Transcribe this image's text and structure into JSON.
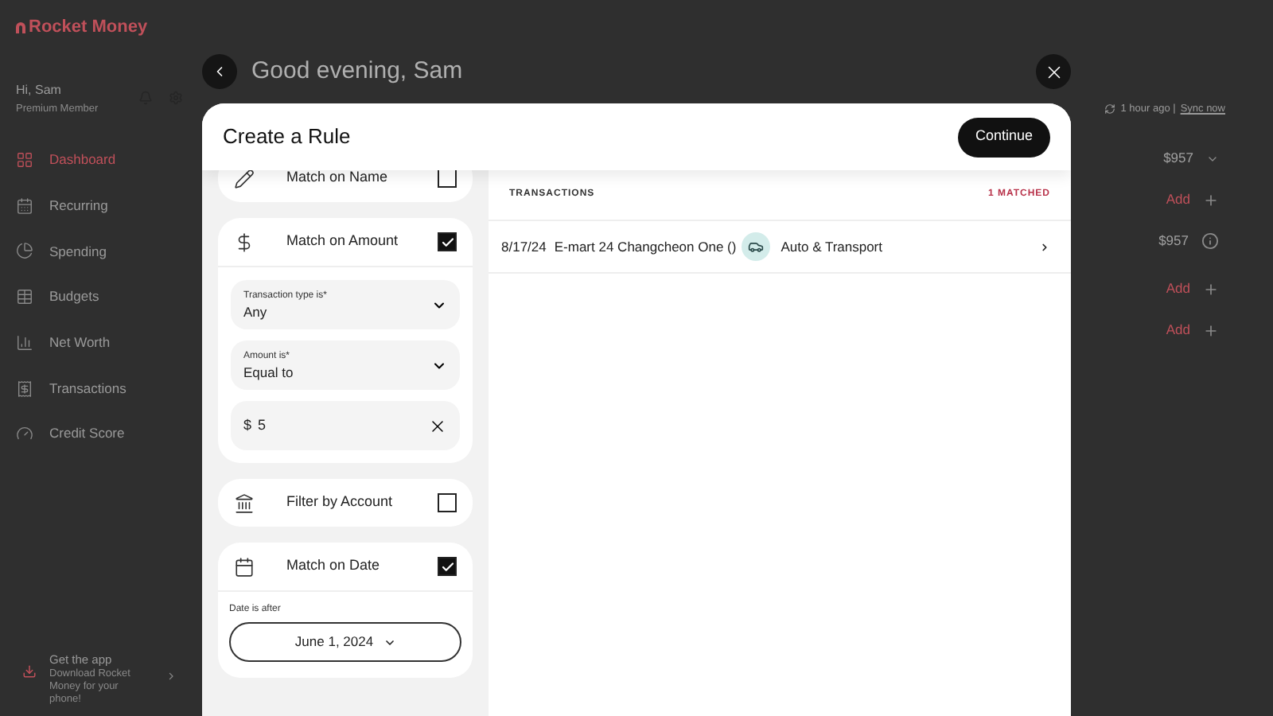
{
  "brand": "Rocket Money",
  "user": {
    "greeting": "Hi, Sam",
    "membership": "Premium Member"
  },
  "nav": [
    {
      "label": "Dashboard",
      "selected": true,
      "kind": "dashboard"
    },
    {
      "label": "Recurring",
      "selected": false,
      "kind": "recurring"
    },
    {
      "label": "Spending",
      "selected": false,
      "kind": "spending"
    },
    {
      "label": "Budgets",
      "selected": false,
      "kind": "budgets"
    },
    {
      "label": "Net Worth",
      "selected": false,
      "kind": "networth"
    },
    {
      "label": "Transactions",
      "selected": false,
      "kind": "transactions"
    },
    {
      "label": "Credit Score",
      "selected": false,
      "kind": "credit"
    }
  ],
  "promo": {
    "title": "Get the app",
    "text": "Download Rocket Money for your phone!"
  },
  "page": {
    "title": "Good evening, Sam",
    "sync": "1 hour ago |",
    "sync_link": "Sync now",
    "rows": [
      {
        "kind": "amount",
        "text": "$957"
      },
      {
        "kind": "add",
        "text": "Add"
      },
      {
        "kind": "info",
        "text": "$957"
      },
      {
        "kind": "add",
        "text": "Add"
      },
      {
        "kind": "add",
        "text": "Add"
      }
    ]
  },
  "modal": {
    "title": "Create a Rule",
    "continue": "Continue",
    "rules": [
      {
        "kind": "name",
        "label": "Match on Name",
        "checked": false
      },
      {
        "kind": "amount",
        "label": "Match on Amount",
        "checked": true,
        "fields": [
          {
            "kind": "select",
            "label": "Transaction type is*",
            "value": "Any"
          },
          {
            "kind": "select",
            "label": "Amount is*",
            "value": "Equal to"
          },
          {
            "kind": "input",
            "prefix": "$",
            "value": "5"
          }
        ]
      },
      {
        "kind": "account",
        "label": "Filter by Account",
        "checked": false
      },
      {
        "kind": "date",
        "label": "Match on Date",
        "checked": true,
        "date_label": "Date is after",
        "date": "June 1, 2024"
      }
    ],
    "transactions": {
      "heading": "TRANSACTIONS",
      "matched": "1 MATCHED",
      "rows": [
        {
          "date": "8/17/24",
          "name": "E-mart 24 Changcheon One ()",
          "category": "Auto & Transport"
        }
      ]
    }
  }
}
